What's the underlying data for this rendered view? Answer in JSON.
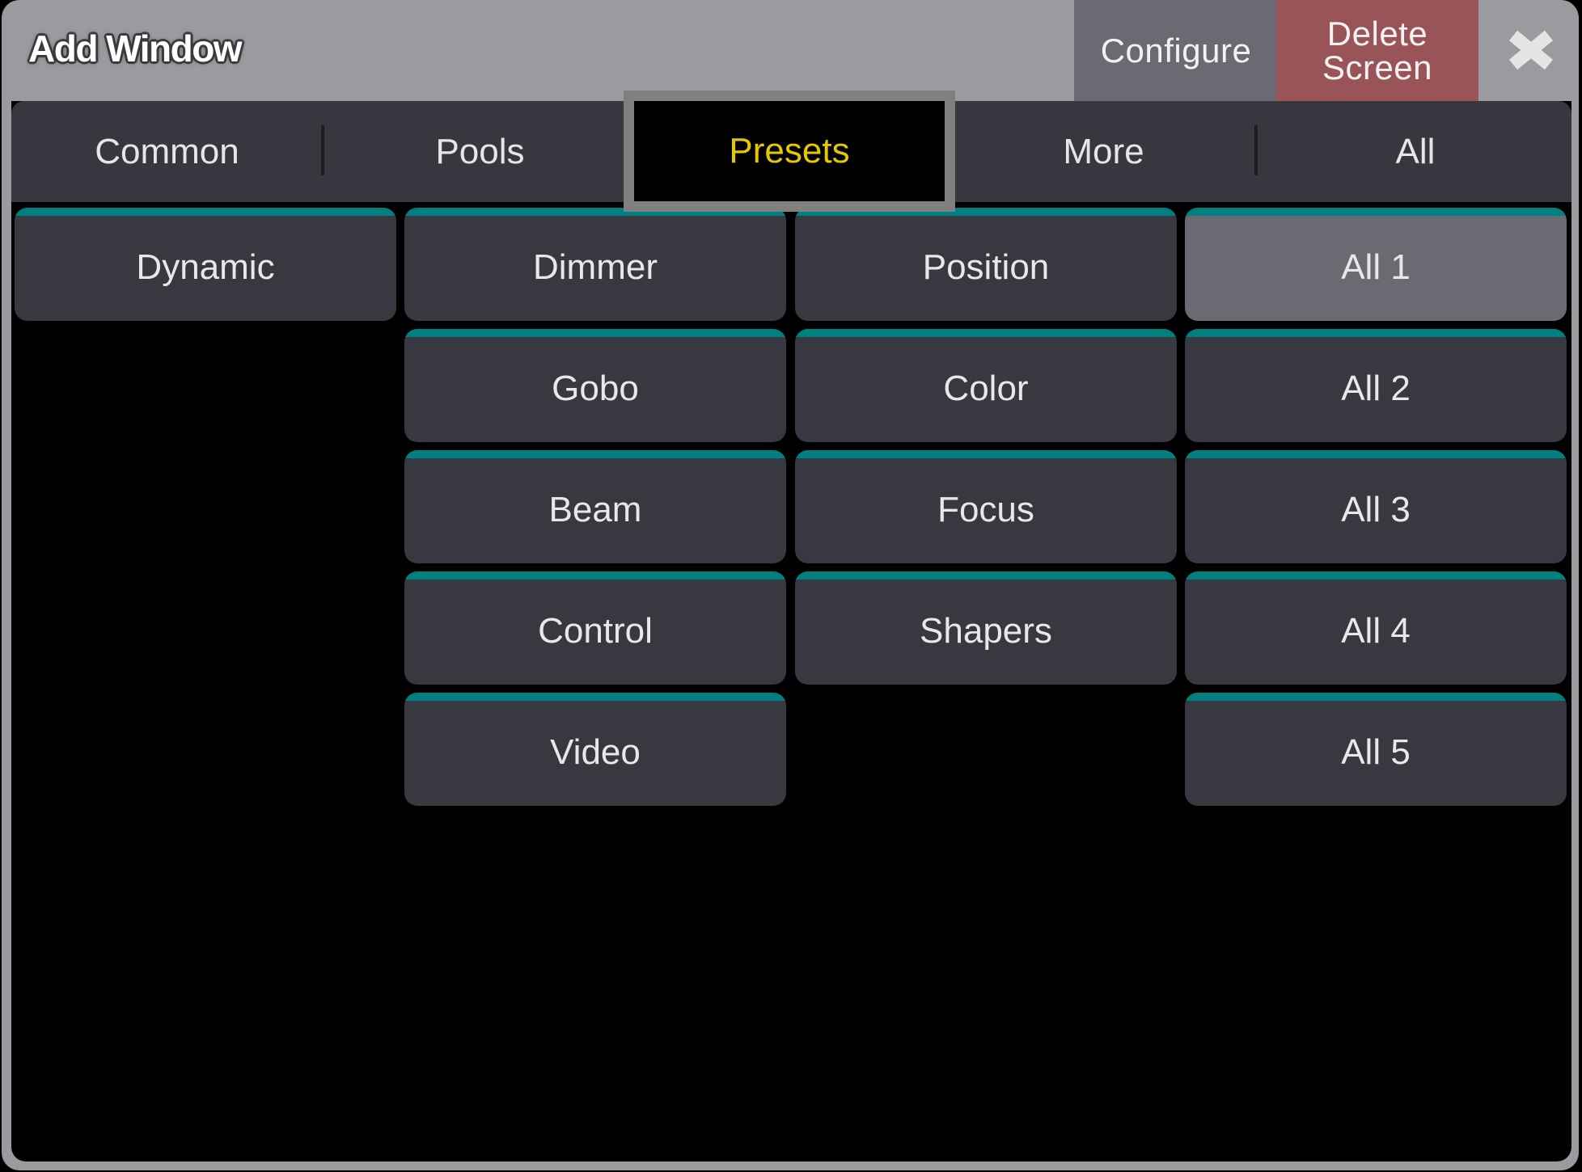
{
  "window": {
    "title": "Add Window",
    "header_buttons": {
      "configure": "Configure",
      "delete_line1": "Delete",
      "delete_line2": "Screen",
      "close_icon": "close-icon"
    }
  },
  "tabs": [
    {
      "label": "Common",
      "selected": false
    },
    {
      "label": "Pools",
      "selected": false
    },
    {
      "label": "Presets",
      "selected": true
    },
    {
      "label": "More",
      "selected": false
    },
    {
      "label": "All",
      "selected": false
    }
  ],
  "grid": {
    "columns": [
      [
        {
          "label": "Dynamic",
          "selected": false
        }
      ],
      [
        {
          "label": "Dimmer",
          "selected": false
        },
        {
          "label": "Gobo",
          "selected": false
        },
        {
          "label": "Beam",
          "selected": false
        },
        {
          "label": "Control",
          "selected": false
        },
        {
          "label": "Video",
          "selected": false
        }
      ],
      [
        {
          "label": "Position",
          "selected": false
        },
        {
          "label": "Color",
          "selected": false
        },
        {
          "label": "Focus",
          "selected": false
        },
        {
          "label": "Shapers",
          "selected": false
        }
      ],
      [
        {
          "label": "All 1",
          "selected": true
        },
        {
          "label": "All 2",
          "selected": false
        },
        {
          "label": "All 3",
          "selected": false
        },
        {
          "label": "All 4",
          "selected": false
        },
        {
          "label": "All 5",
          "selected": false
        }
      ]
    ]
  },
  "colors": {
    "accent_bar": "#008080",
    "selected_tab_text": "#e6c800",
    "delete_button": "#985456",
    "configure_button": "#6b6a73"
  }
}
